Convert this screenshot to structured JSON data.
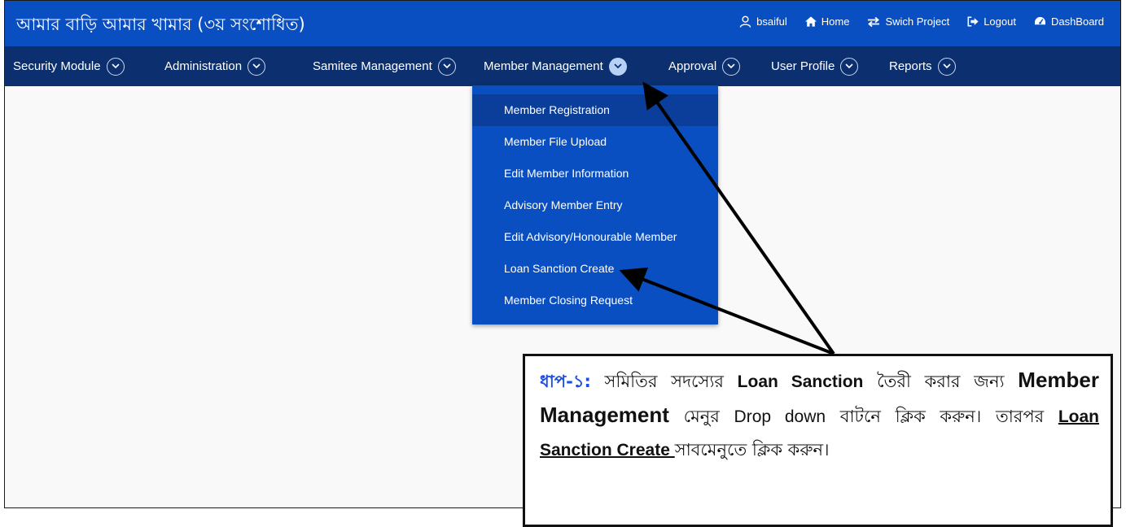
{
  "header": {
    "app_title": "আমার বাড়ি আমার খামার (৩য় সংশোধিত)",
    "links": [
      {
        "icon": "user-icon",
        "label": "bsaiful"
      },
      {
        "icon": "home-icon",
        "label": "Home"
      },
      {
        "icon": "swap-icon",
        "label": "Swich Project"
      },
      {
        "icon": "logout-icon",
        "label": "Logout"
      },
      {
        "icon": "dashboard-icon",
        "label": "DashBoard"
      }
    ]
  },
  "nav": {
    "items": [
      {
        "label": "Security Module"
      },
      {
        "label": "Administration"
      },
      {
        "label": "Samitee Management"
      },
      {
        "label": "Member Management",
        "active": true
      },
      {
        "label": "Approval"
      },
      {
        "label": "User Profile"
      },
      {
        "label": "Reports"
      }
    ],
    "icon": "chevron-down-icon"
  },
  "dropdown": {
    "items": [
      {
        "label": "Member Registration",
        "active": true
      },
      {
        "label": "Member File Upload"
      },
      {
        "label": "Edit Member Information"
      },
      {
        "label": "Advisory Member Entry"
      },
      {
        "label": "Edit Advisory/Honourable Member"
      },
      {
        "label": "Loan Sanction Create"
      },
      {
        "label": "Member Closing Request"
      }
    ]
  },
  "callout": {
    "step": "ধাপ-১:",
    "t1": " সমিতির সদস্যের ",
    "b1": "Loan Sanction",
    "t2": " তৈরী করার জন্য ",
    "b2": "Member Management",
    "t3": " মেনুর ",
    "t4": "Drop down",
    "t5": " বাটনে ক্লিক করুন। তারপর ",
    "b3": "Loan Sanction Create ",
    "t6": "সাবমেনুতে ক্লিক করুন।"
  },
  "colors": {
    "header_bg": "#0a4fc2",
    "nav_bg": "#0b2f6f",
    "dropdown_bg": "#0a4fc2",
    "step_label": "#1b4ee5"
  }
}
